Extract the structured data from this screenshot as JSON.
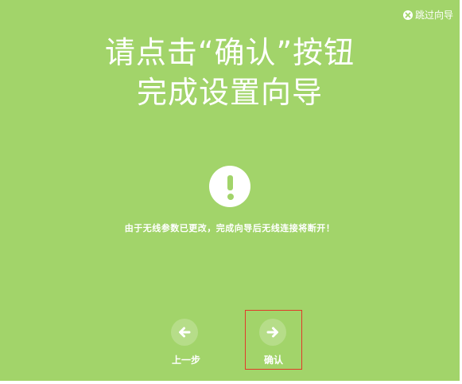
{
  "skip": {
    "label": "跳过向导"
  },
  "title": {
    "line1": "请点击“确认”按钮",
    "line2": "完成设置向导"
  },
  "message": "由于无线参数已更改，完成向导后无线连接将断开！",
  "buttons": {
    "prev_label": "上一步",
    "confirm_label": "确认"
  },
  "colors": {
    "background": "#a2d46a",
    "button_circle": "#b6dd89",
    "highlight_border": "#e03a2a",
    "text": "#ffffff"
  },
  "icons": {
    "skip": "close-circle-icon",
    "alert": "exclamation-circle-icon",
    "prev": "arrow-left-icon",
    "confirm": "arrow-right-icon"
  }
}
